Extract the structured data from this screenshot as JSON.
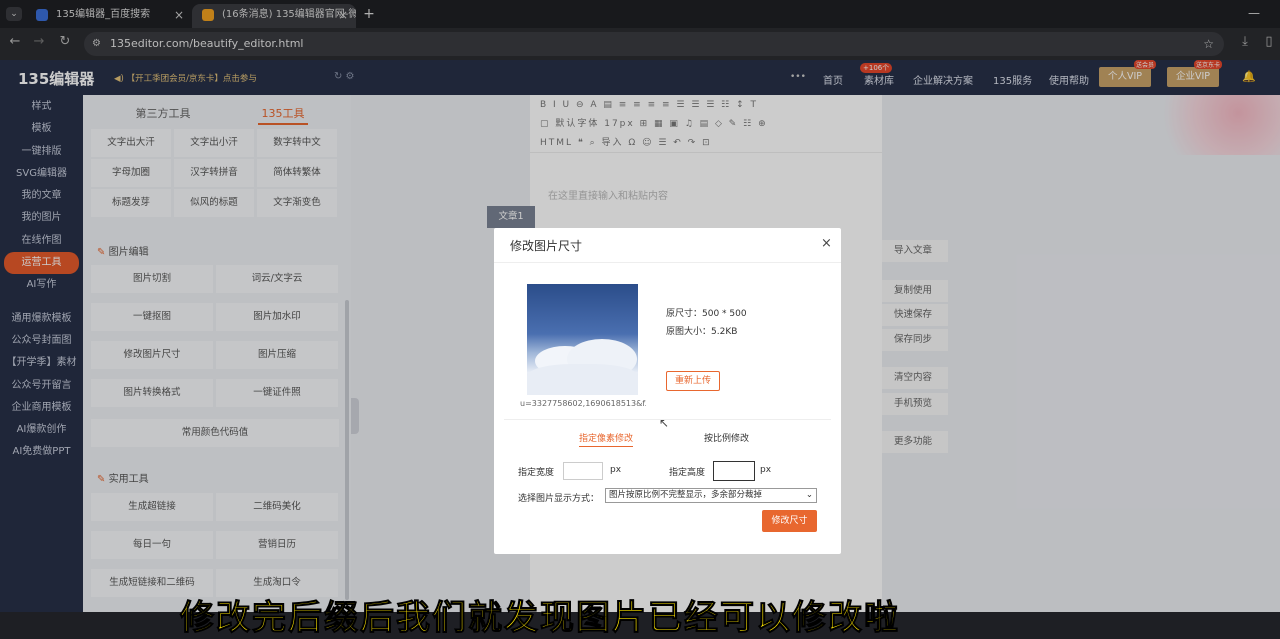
{
  "browser": {
    "tabs": [
      {
        "label": "135编辑器_百度搜索",
        "close": "×"
      },
      {
        "label": "(16条消息) 135编辑器官网-微",
        "close": "×"
      }
    ],
    "new_tab": "+",
    "url": "135editor.com/beautify_editor.html"
  },
  "site": {
    "logo": "135编辑器",
    "promo": "【开工季团会员/京东卡】点击参与",
    "nav": [
      "首页",
      "素材库",
      "企业解决方案",
      "135服务",
      "使用帮助"
    ],
    "nav_more": "•••",
    "badge": "+106个",
    "vip_personal": "个人VIP",
    "vip_personal_tag": "送会员",
    "vip_enterprise": "企业VIP",
    "vip_enterprise_tag": "送京东卡",
    "left_menu": [
      "样式",
      "模板",
      "一键排版",
      "SVG编辑器",
      "我的文章",
      "我的图片",
      "在线作图",
      "运营工具",
      "AI写作",
      "通用爆款模板",
      "公众号封面图",
      "【开学季】素材",
      "公众号开留言",
      "企业商用模板",
      "AI爆款创作",
      "AI免费做PPT"
    ],
    "active_menu": "运营工具",
    "tool_tabs": [
      "第三方工具",
      "135工具"
    ],
    "text_tools": [
      "文字出大汗",
      "文字出小汗",
      "数字转中文",
      "字母加圈",
      "汉字转拼音",
      "简体转繁体",
      "标题发芽",
      "似风的标题",
      "文字渐变色"
    ],
    "image_section": "图片编辑",
    "image_tools": [
      "图片切割",
      "词云/文字云",
      "一键抠图",
      "图片加水印",
      "修改图片尺寸",
      "图片压缩",
      "图片转换格式",
      "一键证件照"
    ],
    "color_tool": "常用颜色代码值",
    "util_section": "实用工具",
    "util_tools": [
      "生成超链接",
      "二维码美化",
      "每日一句",
      "营销日历",
      "生成短链接和二维码",
      "生成淘口令"
    ],
    "editor_placeholder": "在这里直接输入和粘贴内容",
    "article_tab": "文章1",
    "right_buttons": [
      "导入文章",
      "复制使用",
      "快速保存",
      "保存同步",
      "清空内容",
      "手机预览",
      "更多功能"
    ]
  },
  "modal": {
    "title": "修改图片尺寸",
    "close": "×",
    "filename": "u=3327758602,1690618513&f...",
    "original_size_label": "原尺寸：",
    "original_size": "500 * 500",
    "file_size_label": "原图大小：",
    "file_size": "5.2KB",
    "reupload": "重新上传",
    "tabs": [
      "指定像素修改",
      "按比例修改"
    ],
    "active_tab": 0,
    "width_label": "指定宽度",
    "height_label": "指定高度",
    "unit": "px",
    "width_value": "",
    "height_value": "",
    "display_mode_label": "选择图片显示方式：",
    "display_mode": "图片按原比例不完整显示，多余部分裁掉",
    "submit": "修改尺寸"
  },
  "subtitle": "修改完后缀后我们就发现图片已经可以修改啦",
  "colors": {
    "accent": "#e8672f",
    "nav": "#273048"
  }
}
